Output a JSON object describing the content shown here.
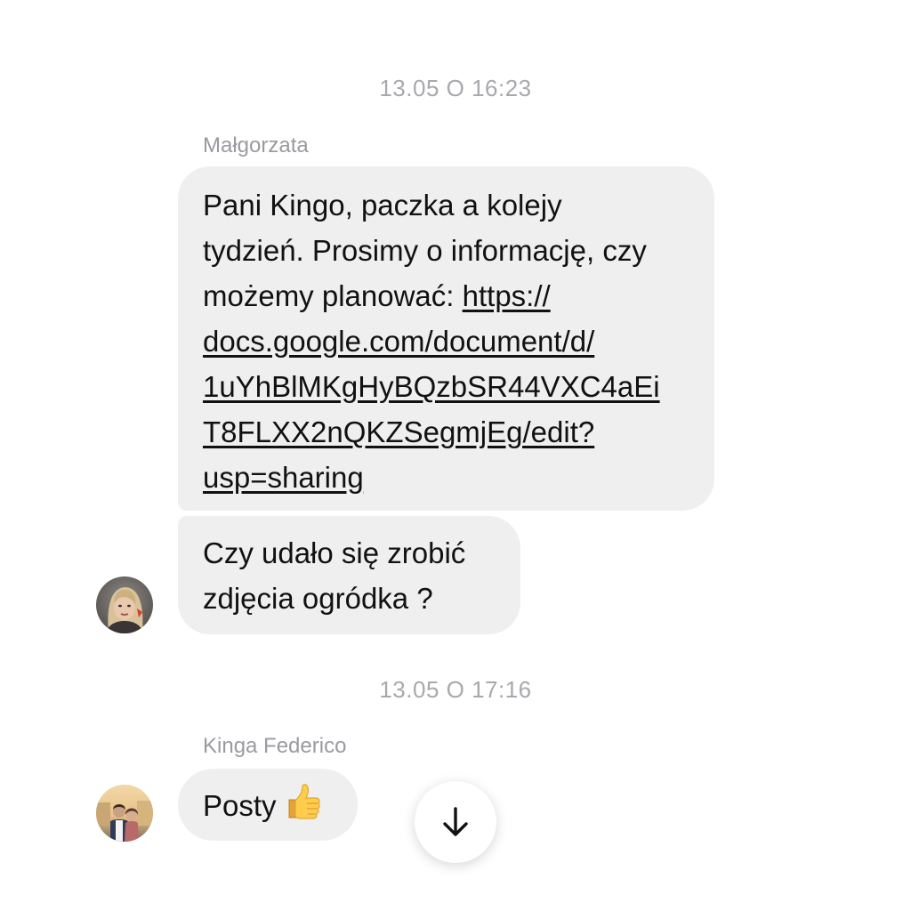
{
  "conversation": {
    "groups": [
      {
        "timestamp": "13.05 O 16:23",
        "sender": "Małgorzata",
        "messages": [
          {
            "lines": [
              "Pani Kingo, paczka a kolejy",
              "tydzień. Prosimy o informację, czy",
              "możemy planować: "
            ],
            "link_lines": [
              "https://",
              "docs.google.com/document/d/",
              "1uYhBlMKgHyBQzbSR44VXC4aEi",
              "T8FLXX2nQKZSegmjEg/edit?",
              "usp=sharing"
            ]
          },
          {
            "lines": [
              "Czy udało się zrobić",
              "zdjęcia ogródka ?"
            ]
          }
        ]
      },
      {
        "timestamp": "13.05 O 17:16",
        "sender": "Kinga Federico",
        "messages": [
          {
            "text": "Posty",
            "emoji": "thumbs-up-icon"
          }
        ]
      }
    ]
  },
  "icons": {
    "scroll_down": "arrow-down-icon",
    "avatar_1": "avatar-malgorzata",
    "avatar_2": "avatar-kinga"
  },
  "colors": {
    "bubble_bg": "#efeff0",
    "timestamp": "#a8a8ad",
    "sender": "#9a9aa0",
    "text": "#111111"
  }
}
